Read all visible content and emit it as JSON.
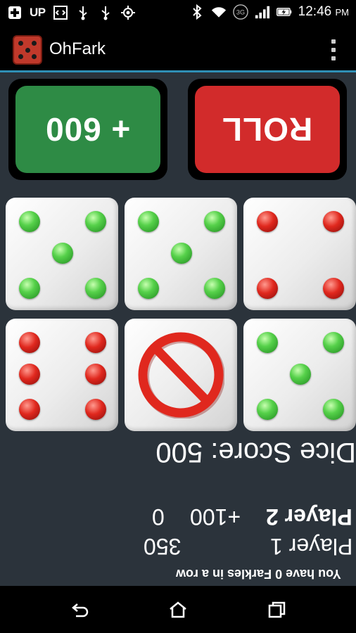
{
  "status_bar": {
    "left_icons": [
      "add-icon",
      "up-arrows-icon",
      "code-icon",
      "usb-icon",
      "usb-icon",
      "gps-icon"
    ],
    "up_label": "UP",
    "network_label": "3G",
    "time": "12:46",
    "ampm": "PM",
    "right_icons": [
      "bluetooth-icon",
      "wifi-icon",
      "network-3g-icon",
      "signal-icon",
      "battery-charging-icon"
    ]
  },
  "app_bar": {
    "title": "OhFark",
    "icon": "dice-icon",
    "menu_icon": "overflow-menu-icon"
  },
  "game": {
    "score_button_label": "+ 600",
    "roll_button_label": "ROLL",
    "colors": {
      "background": "#2b333b",
      "score_button": "#2e8b45",
      "roll_button": "#d22b2b",
      "pip_green": "#3fbf3a",
      "pip_red": "#d0201a",
      "accent_line": "#2f8fb5"
    },
    "dice": [
      {
        "value": 5,
        "pip_color": "green"
      },
      {
        "value": 5,
        "pip_color": "green"
      },
      {
        "value": 4,
        "pip_color": "red"
      },
      {
        "value": 6,
        "pip_color": "red"
      },
      {
        "value": null,
        "blocked": true,
        "icon": "no-entry-icon"
      },
      {
        "value": 5,
        "pip_color": "green"
      }
    ],
    "dice_score_label": "Dice Score: 500",
    "players": [
      {
        "name": "Player 2",
        "round_score": "+100",
        "total": "0",
        "active": true
      },
      {
        "name": "Player 1",
        "round_score": "",
        "total": "350",
        "active": false
      }
    ],
    "farkles_message": "You have 0 Farkles in a row"
  },
  "nav_bar": {
    "icons": [
      "back-icon",
      "home-icon",
      "recent-apps-icon"
    ]
  }
}
